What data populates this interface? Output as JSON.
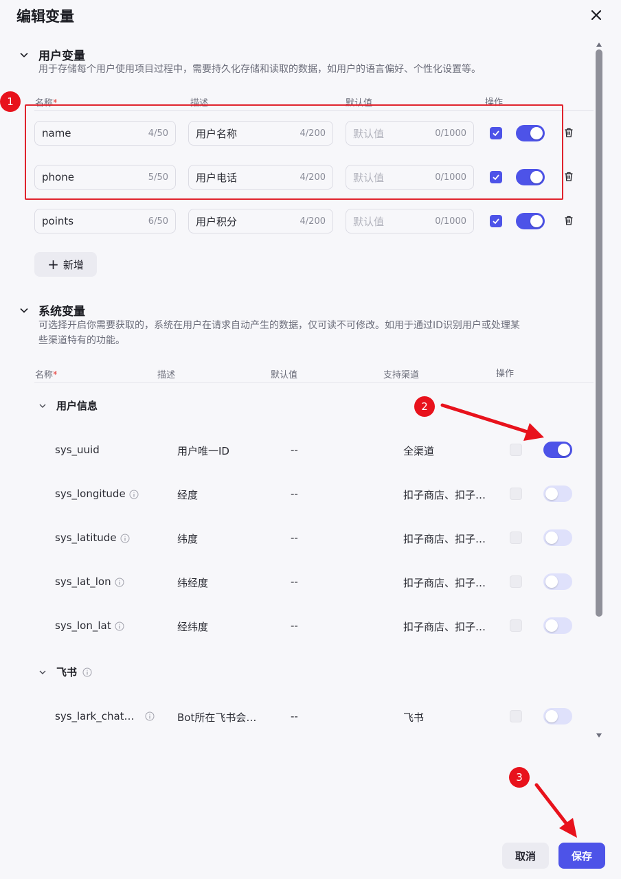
{
  "dialog": {
    "title": "编辑变量"
  },
  "user_section": {
    "title": "用户变量",
    "description": "用于存储每个用户使用项目过程中，需要持久化存储和读取的数据，如用户的语言偏好、个性化设置等。",
    "columns": {
      "name": "名称",
      "required_mark": "*",
      "desc": "描述",
      "default": "默认值",
      "ops": "操作"
    },
    "rows": [
      {
        "name": "name",
        "name_count": "4/50",
        "desc": "用户名称",
        "desc_count": "4/200",
        "default_placeholder": "默认值",
        "default_count": "0/1000",
        "checked": true,
        "enabled": true
      },
      {
        "name": "phone",
        "name_count": "5/50",
        "desc": "用户电话",
        "desc_count": "4/200",
        "default_placeholder": "默认值",
        "default_count": "0/1000",
        "checked": true,
        "enabled": true
      },
      {
        "name": "points",
        "name_count": "6/50",
        "desc": "用户积分",
        "desc_count": "4/200",
        "default_placeholder": "默认值",
        "default_count": "0/1000",
        "checked": true,
        "enabled": true
      }
    ],
    "add_label": "新增"
  },
  "system_section": {
    "title": "系统变量",
    "description_line1": "可选择开启你需要获取的，系统在用户在请求自动产生的数据，仅可读不可修改。如用于通过ID识别用户或处理某",
    "description_line2": "些渠道特有的功能。",
    "columns": {
      "name": "名称",
      "required_mark": "*",
      "desc": "描述",
      "default": "默认值",
      "channel": "支持渠道",
      "ops": "操作"
    },
    "groups": [
      {
        "title": "用户信息",
        "rows": [
          {
            "name": "sys_uuid",
            "desc": "用户唯一ID",
            "default": "--",
            "channel": "全渠道",
            "enabled": true
          },
          {
            "name": "sys_longitude",
            "desc": "经度",
            "default": "--",
            "channel": "扣子商店、扣子…",
            "enabled": false
          },
          {
            "name": "sys_latitude",
            "desc": "纬度",
            "default": "--",
            "channel": "扣子商店、扣子…",
            "enabled": false
          },
          {
            "name": "sys_lat_lon",
            "desc": "纬经度",
            "default": "--",
            "channel": "扣子商店、扣子…",
            "enabled": false
          },
          {
            "name": "sys_lon_lat",
            "desc": "经纬度",
            "default": "--",
            "channel": "扣子商店、扣子…",
            "enabled": false
          }
        ]
      },
      {
        "title": "飞书",
        "rows": [
          {
            "name": "sys_lark_chat…",
            "desc": "Bot所在飞书会…",
            "default": "--",
            "channel": "飞书",
            "enabled": false
          }
        ]
      }
    ]
  },
  "annotations": {
    "badge1": "1",
    "badge2": "2",
    "badge3": "3"
  },
  "footer": {
    "cancel_label": "取消",
    "save_label": "保存"
  },
  "colors": {
    "accent": "#4d53e8",
    "annotation_red": "#e8121c"
  }
}
